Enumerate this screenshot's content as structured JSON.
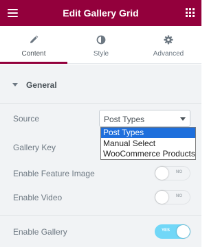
{
  "header": {
    "title": "Edit Gallery Grid",
    "menu_icon": "hamburger-icon",
    "grid_icon": "apps-grid-icon"
  },
  "tabs": [
    {
      "label": "Content",
      "icon": "pencil-icon",
      "active": true
    },
    {
      "label": "Style",
      "icon": "half-circle-icon",
      "active": false
    },
    {
      "label": "Advanced",
      "icon": "gear-icon",
      "active": false
    }
  ],
  "section": {
    "title": "General"
  },
  "fields": {
    "source": {
      "label": "Source",
      "value": "Post Types",
      "options": [
        "Post Types",
        "Manual Select",
        "WooCommerce Products"
      ]
    },
    "gallery_key": {
      "label": "Gallery Key"
    },
    "enable_feature_image": {
      "label": "Enable Feature Image",
      "toggle_text": "NO",
      "on": false
    },
    "enable_video": {
      "label": "Enable Video",
      "toggle_text": "NO",
      "on": false
    },
    "enable_gallery": {
      "label": "Enable Gallery",
      "toggle_text": "YES",
      "on": true
    }
  },
  "colors": {
    "header_bg": "#93003c",
    "panel_bg": "#f1f3f5",
    "toggle_on": "#71d7f7",
    "option_highlight": "#1e6fdc"
  }
}
